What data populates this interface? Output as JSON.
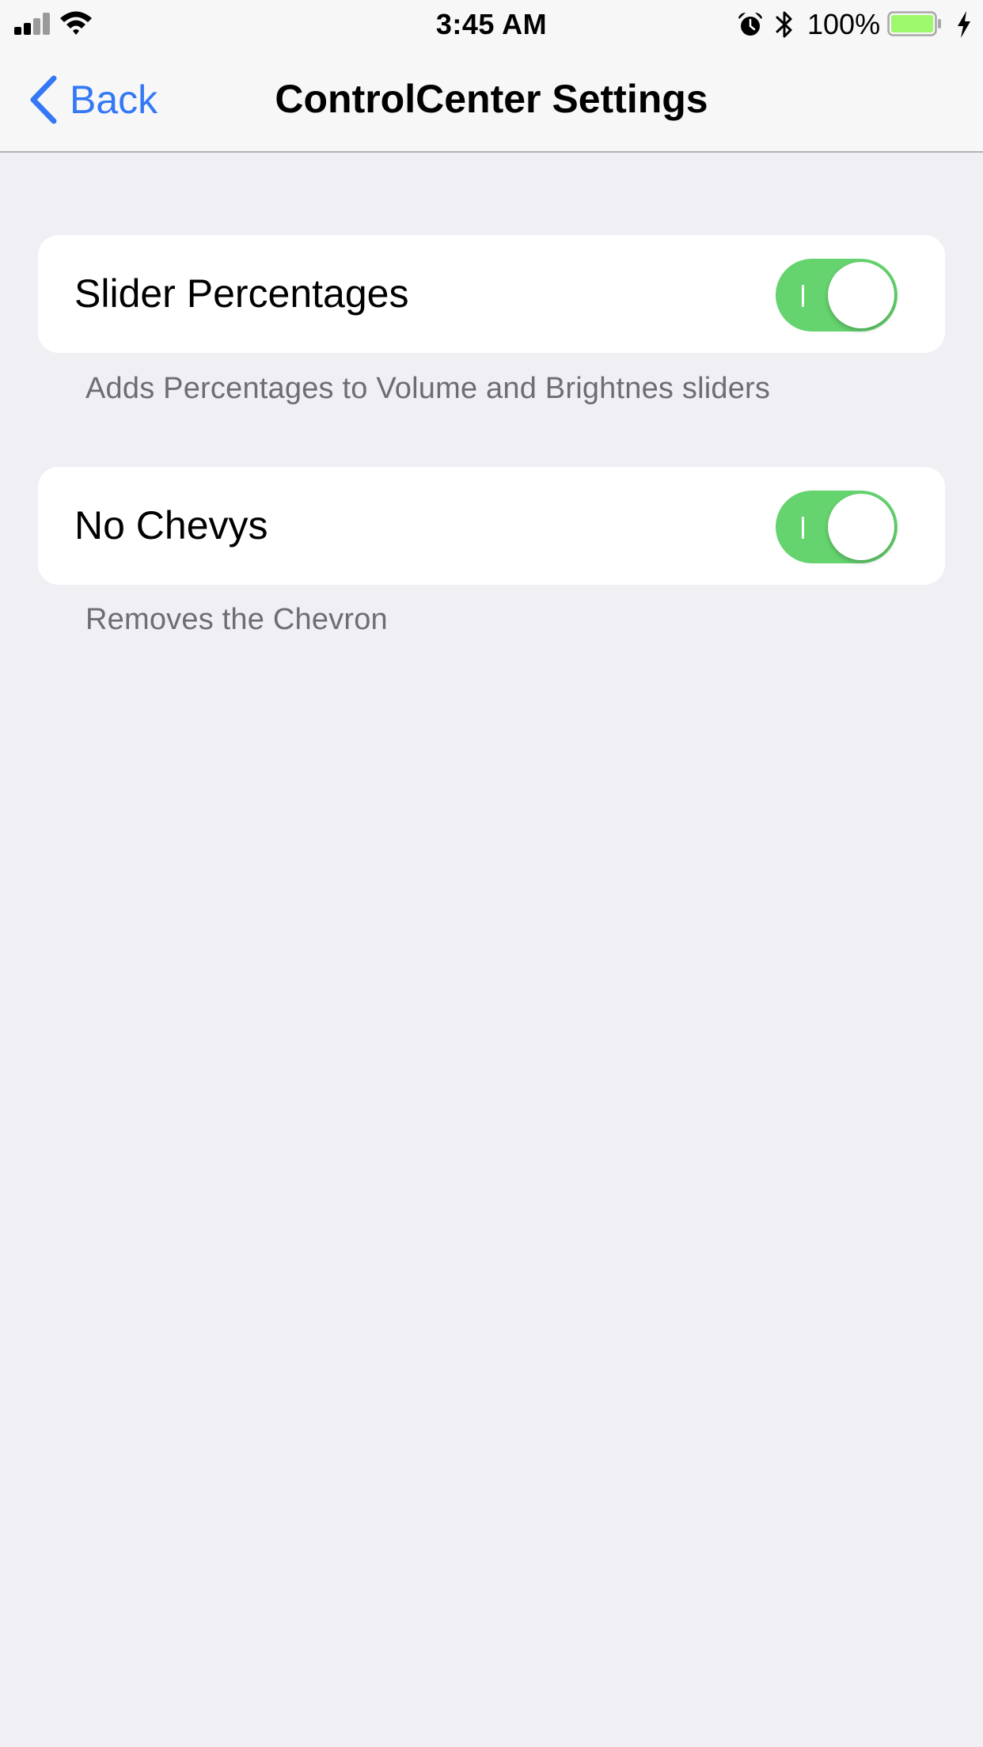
{
  "status_bar": {
    "time": "3:45 AM",
    "battery_percent": "100%",
    "icons": [
      "signal-icon",
      "wifi-icon",
      "alarm-icon",
      "bluetooth-icon",
      "battery-icon",
      "charging-icon"
    ],
    "battery_level": 1.0,
    "battery_color": "#9ef86b"
  },
  "nav": {
    "back_label": "Back",
    "title": "ControlCenter Settings",
    "accent_color": "#3478f6"
  },
  "settings": [
    {
      "label": "Slider Percentages",
      "enabled": true,
      "footer": "Adds Percentages to Volume and Brightnes sliders"
    },
    {
      "label": "No Chevys",
      "enabled": true,
      "footer": "Removes the Chevron"
    }
  ],
  "colors": {
    "toggle_on": "#65d36e",
    "background": "#efeff4",
    "footer_text": "#6d6d72"
  }
}
